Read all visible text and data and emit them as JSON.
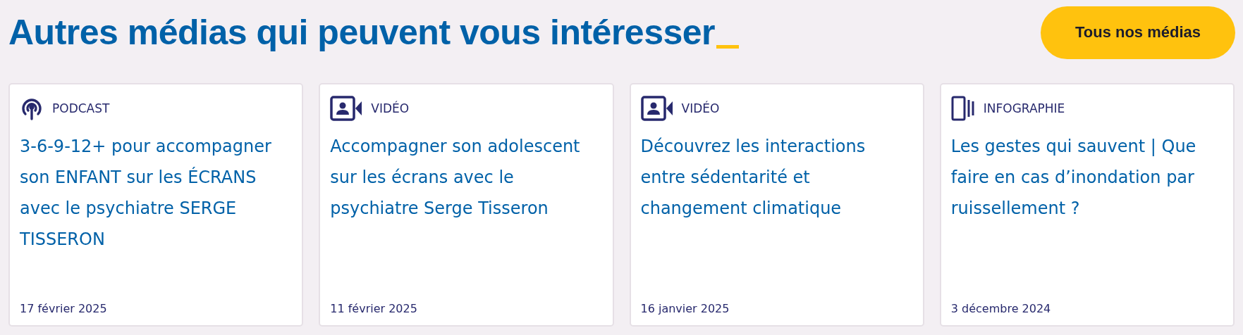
{
  "heading": "Autres médias qui peuvent vous intéresser",
  "button": "Tous nos médias",
  "cards": [
    {
      "kind": "podcast",
      "type_label": "PODCAST",
      "title": "3-6-9-12+ pour accompagner son ENFANT sur les ÉCRANS avec le psychiatre SERGE TISSERON",
      "date": "17 février 2025"
    },
    {
      "kind": "video",
      "type_label": "VIDÉO",
      "title": "Accompagner son adolescent sur les écrans avec le psychiatre Serge Tisseron",
      "date": "11 février 2025"
    },
    {
      "kind": "video",
      "type_label": "VIDÉO",
      "title": "Découvrez les interactions entre sédentarité et changement climatique",
      "date": "16 janvier 2025"
    },
    {
      "kind": "infographic",
      "type_label": "INFOGRAPHIE",
      "title": "Les gestes qui sauvent | Que faire en cas d’inondation par ruissellement ?",
      "date": "3 décembre 2024"
    }
  ]
}
